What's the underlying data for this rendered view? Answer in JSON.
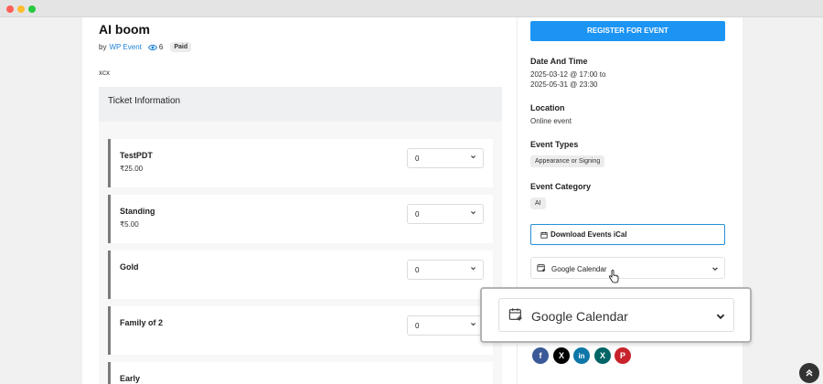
{
  "event": {
    "title": "AI boom",
    "by_label": "by",
    "author": "WP Event",
    "views": "6",
    "badge": "Paid",
    "description": "xcx"
  },
  "tickets": {
    "header": "Ticket Information",
    "items": [
      {
        "name": "TestPDT",
        "price": "₹25.00",
        "qty": "0"
      },
      {
        "name": "Standing",
        "price": "₹5.00",
        "qty": "0"
      },
      {
        "name": "Gold",
        "price": "",
        "qty": "0"
      },
      {
        "name": "Family of 2",
        "price": "",
        "qty": "0"
      },
      {
        "name": "Early",
        "price": "",
        "qty": ""
      }
    ]
  },
  "sidebar": {
    "register_label": "REGISTER FOR EVENT",
    "date_label": "Date And Time",
    "date_line1": "2025-03-12 @ 17:00 to",
    "date_line2": "2025-05-31 @ 23:30",
    "location_label": "Location",
    "location_value": "Online event",
    "types_label": "Event Types",
    "types_value": "Appearance or Signing",
    "category_label": "Event Category",
    "category_value": "AI",
    "ical_label": "Download Events iCal",
    "calendar_select": "Google Calendar"
  },
  "zoom": {
    "calendar_select": "Google Calendar"
  },
  "share": {
    "icons": [
      "facebook-icon",
      "x-icon",
      "linkedin-icon",
      "xing-icon",
      "pinterest-icon"
    ],
    "facebook": "f",
    "x": "X",
    "linkedin": "in",
    "xing": "X",
    "pinterest": "P"
  },
  "colors": {
    "accent": "#1c94f4",
    "facebook": "#3b5998",
    "x": "#000000",
    "linkedin": "#0e76a8",
    "xing": "#026466",
    "pinterest": "#c8232c"
  }
}
